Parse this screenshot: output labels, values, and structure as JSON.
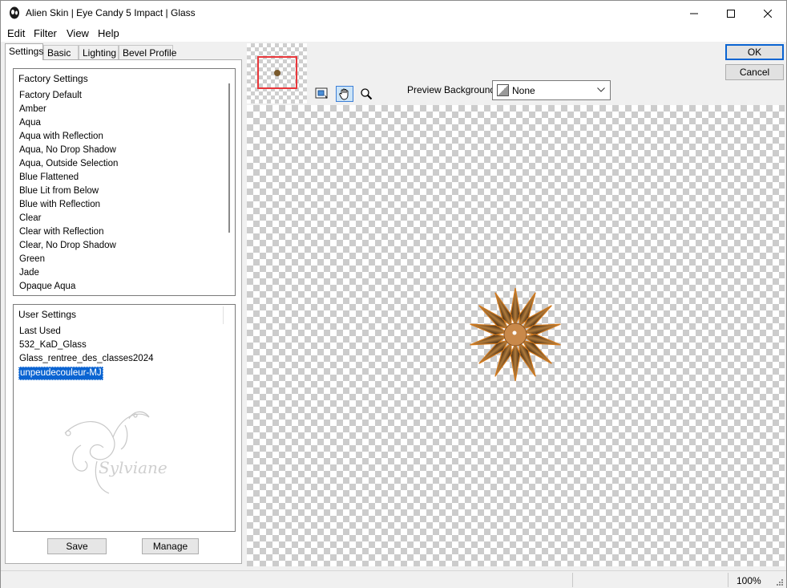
{
  "window": {
    "title": "Alien Skin | Eye Candy 5 Impact | Glass"
  },
  "menu": {
    "edit": "Edit",
    "filter": "Filter",
    "view": "View",
    "help": "Help"
  },
  "tabs": [
    "Settings",
    "Basic",
    "Lighting",
    "Bevel Profile"
  ],
  "factory": {
    "header": "Factory Settings",
    "items": [
      "Factory Default",
      "Amber",
      "Aqua",
      "Aqua with Reflection",
      "Aqua, No Drop Shadow",
      "Aqua, Outside Selection",
      "Blue Flattened",
      "Blue Lit from Below",
      "Blue with Reflection",
      "Clear",
      "Clear with Reflection",
      "Clear, No Drop Shadow",
      "Green",
      "Jade",
      "Opaque Aqua"
    ]
  },
  "user": {
    "header": "User Settings",
    "items": [
      "Last Used",
      "532_KaD_Glass",
      "Glass_rentree_des_classes2024",
      "unpeudecouleur-MJ"
    ],
    "selected": "unpeudecouleur-MJ"
  },
  "watermark": "Sylviane",
  "buttons": {
    "save": "Save",
    "manage": "Manage",
    "ok": "OK",
    "cancel": "Cancel"
  },
  "preview": {
    "label": "Preview Background:",
    "value": "None"
  },
  "status": {
    "zoom": "100%"
  },
  "icons": {
    "nav": "navigator-icon",
    "hand": "hand-pan-icon",
    "zoom": "zoom-icon"
  },
  "colors": {
    "accent": "#0a64d2",
    "thumb_frame": "#e8373b",
    "flower_center": "#c9894a",
    "petal": "#5a3d1c"
  }
}
